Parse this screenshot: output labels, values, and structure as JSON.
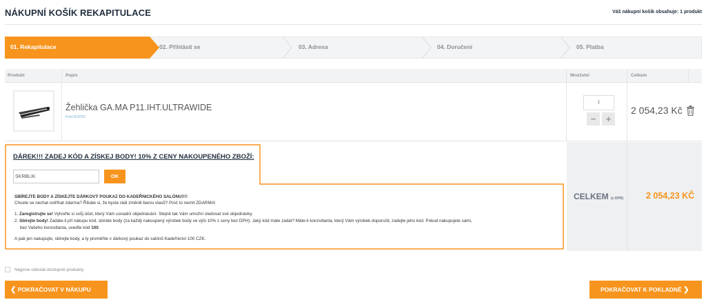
{
  "page": {
    "title": "NÁKUPNÍ KOŠÍK REKAPITULACE",
    "cart_info": "Váš nákupní košík obsahuje: 1 produkt"
  },
  "steps": [
    {
      "label": "01. Rekapitulace",
      "active": true
    },
    {
      "label": "02. Přihlásit se",
      "active": false
    },
    {
      "label": "03. Adresa",
      "active": false
    },
    {
      "label": "04. Doručení",
      "active": false
    },
    {
      "label": "05. Platba",
      "active": false
    }
  ],
  "table": {
    "headers": {
      "product": "Produkt",
      "description": "Popis",
      "quantity": "Množství",
      "total": "Celkem"
    },
    "item": {
      "name": "Žehlička GA.MA P11.IHT.ULTRAWIDE",
      "code": "Kód:SI3030",
      "quantity": "1",
      "minus": "−",
      "plus": "+",
      "total": "2 054,23 Kč"
    }
  },
  "gift": {
    "title": "DÁREK!!! ZADEJ KÓD A ZÍSKEJ BODY! 10% Z CENY NAKOUPENÉHO ZBOŽÍ:",
    "code_value": "SKRBLIK",
    "ok_label": "OK",
    "heading": "SBÍREJTE BODY A ZÍSKEJTE DÁRKOVÝ POUKAZ DO KADEŘNICKÉHO SALÓNU!!!!",
    "intro": "Chcete se nechat ostříhat zdarma? Říkáte si, že byste rádi změnili barvu vlasů? Proč to nemít ZDARMA!",
    "step1_bold": "Zaregistrujte se!",
    "step1_text": " Vytvořte si svůj účet, který Vám usnadní objednávání. Stejně tak Vám umožní sledovat své objednávky.",
    "step2_bold": "Sbírejte body!",
    "step2_text": " Zadáte-li při nákupu kód, sbíráte body (za každý nakoupený výrobek body ve výši 10% z ceny bez DPH). Jaký kód máte zadat? Máte-li konzultanta, který Vám výrobek doporučil, zadejte jeho kód. Pokud nakupujete sami,",
    "step2_cont": "bez Vašeho konzultanta, uveďte kód ",
    "step2_code": "100",
    "step2_end": ".",
    "outro": "A pak jen nakupujte, sbírejte body, a ty proměňte v dárkový poukaz do salónů Kadeřnictví 100 CZK."
  },
  "summary": {
    "label": "CELKEM",
    "sub": "(s DPH)",
    "value": "2 054,23 KČ"
  },
  "options": {
    "available_first": "Nejprve odeslat dostupné produkty"
  },
  "buttons": {
    "back": "POKRAČOVAT V NÁKUPU",
    "next": "POKRAČOVAT K POKLADNĚ"
  },
  "colors": {
    "accent": "#f7941d",
    "heading": "#23303f"
  }
}
